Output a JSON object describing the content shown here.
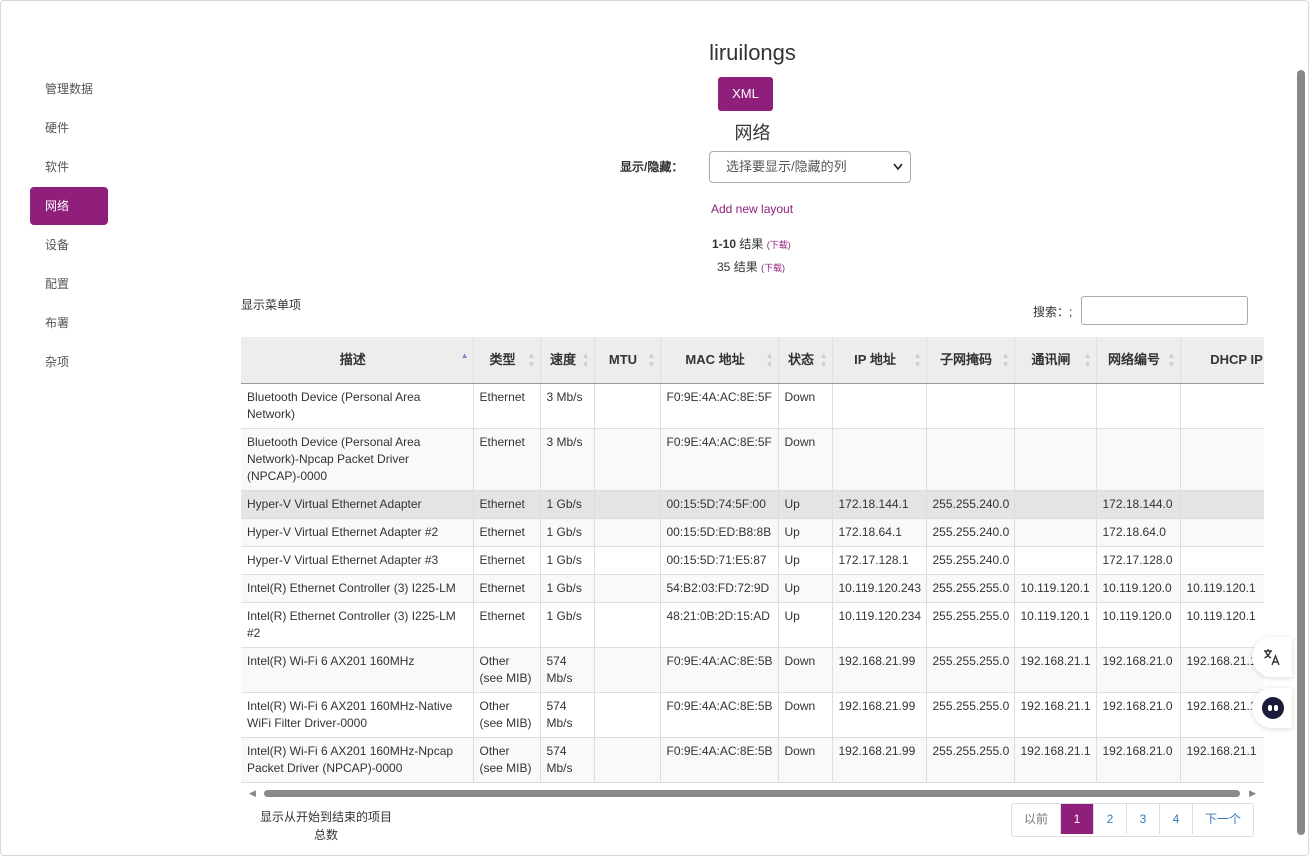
{
  "sidebar": {
    "items": [
      {
        "label": "管理数据",
        "active": false
      },
      {
        "label": "硬件",
        "active": false
      },
      {
        "label": "软件",
        "active": false
      },
      {
        "label": "网络",
        "active": true
      },
      {
        "label": "设备",
        "active": false
      },
      {
        "label": "配置",
        "active": false
      },
      {
        "label": "布署",
        "active": false
      },
      {
        "label": "杂项",
        "active": false
      }
    ]
  },
  "header": {
    "title": "liruilongs",
    "xml_label": "XML",
    "section": "网络",
    "showhide_label": "显示/隐藏：",
    "select_value": "选择要显示/隐藏的列",
    "add_layout": "Add new layout",
    "results_range": "1-10",
    "results_word": "结果",
    "download": "(下载)",
    "total_count": "35",
    "menu_items": "显示菜单项",
    "search_label": "搜索：;"
  },
  "table": {
    "columns": [
      "描述",
      "类型",
      "速度",
      "MTU",
      "MAC 地址",
      "状态",
      "IP 地址",
      "子网掩码",
      "通讯闸",
      "网络编号",
      "DHCP IP"
    ],
    "rows": [
      [
        "Bluetooth Device (Personal Area Network)",
        "Ethernet",
        "3 Mb/s",
        "",
        "F0:9E:4A:AC:8E:5F",
        "Down",
        "",
        "",
        "",
        "",
        ""
      ],
      [
        "Bluetooth Device (Personal Area Network)-Npcap Packet Driver (NPCAP)-0000",
        "Ethernet",
        "3 Mb/s",
        "",
        "F0:9E:4A:AC:8E:5F",
        "Down",
        "",
        "",
        "",
        "",
        ""
      ],
      [
        "Hyper-V Virtual Ethernet Adapter",
        "Ethernet",
        "1 Gb/s",
        "",
        "00:15:5D:74:5F:00",
        "Up",
        "172.18.144.1",
        "255.255.240.0",
        "",
        "172.18.144.0",
        ""
      ],
      [
        "Hyper-V Virtual Ethernet Adapter #2",
        "Ethernet",
        "1 Gb/s",
        "",
        "00:15:5D:ED:B8:8B",
        "Up",
        "172.18.64.1",
        "255.255.240.0",
        "",
        "172.18.64.0",
        ""
      ],
      [
        "Hyper-V Virtual Ethernet Adapter #3",
        "Ethernet",
        "1 Gb/s",
        "",
        "00:15:5D:71:E5:87",
        "Up",
        "172.17.128.1",
        "255.255.240.0",
        "",
        "172.17.128.0",
        ""
      ],
      [
        "Intel(R) Ethernet Controller (3) I225-LM",
        "Ethernet",
        "1 Gb/s",
        "",
        "54:B2:03:FD:72:9D",
        "Up",
        "10.119.120.243",
        "255.255.255.0",
        "10.119.120.1",
        "10.119.120.0",
        "10.119.120.1"
      ],
      [
        "Intel(R) Ethernet Controller (3) I225-LM #2",
        "Ethernet",
        "1 Gb/s",
        "",
        "48:21:0B:2D:15:AD",
        "Up",
        "10.119.120.234",
        "255.255.255.0",
        "10.119.120.1",
        "10.119.120.0",
        "10.119.120.1"
      ],
      [
        "Intel(R) Wi-Fi 6 AX201 160MHz",
        "Other (see MIB)",
        "574 Mb/s",
        "",
        "F0:9E:4A:AC:8E:5B",
        "Down",
        "192.168.21.99",
        "255.255.255.0",
        "192.168.21.1",
        "192.168.21.0",
        "192.168.21.1"
      ],
      [
        "Intel(R) Wi-Fi 6 AX201 160MHz-Native WiFi Filter Driver-0000",
        "Other (see MIB)",
        "574 Mb/s",
        "",
        "F0:9E:4A:AC:8E:5B",
        "Down",
        "192.168.21.99",
        "255.255.255.0",
        "192.168.21.1",
        "192.168.21.0",
        "192.168.21.1"
      ],
      [
        "Intel(R) Wi-Fi 6 AX201 160MHz-Npcap Packet Driver (NPCAP)-0000",
        "Other (see MIB)",
        "574 Mb/s",
        "",
        "F0:9E:4A:AC:8E:5B",
        "Down",
        "192.168.21.99",
        "255.255.255.0",
        "192.168.21.1",
        "192.168.21.0",
        "192.168.21.1"
      ]
    ]
  },
  "footer": {
    "info_line1": "显示从开始到结束的项目",
    "info_line2": "总数",
    "prev": "以前",
    "pages": [
      "1",
      "2",
      "3",
      "4"
    ],
    "current_page": "1",
    "next": "下一个"
  },
  "colors": {
    "accent": "#8f1f7a"
  }
}
